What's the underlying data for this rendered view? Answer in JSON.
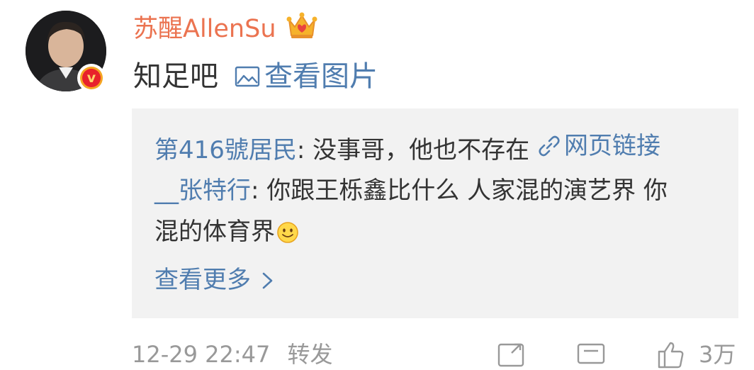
{
  "post": {
    "username": "苏醒AllenSu",
    "text": "知足吧",
    "view_image_label": "查看图片",
    "badge_letter": "v"
  },
  "comments": [
    {
      "name": "第416號居民",
      "separator": ": ",
      "text": "没事哥，他也不存在",
      "link_label": "网页链接"
    },
    {
      "name": "__张特行",
      "separator": ": ",
      "text_line1": "你跟王栎鑫比什么 人家混的演艺界 你",
      "text_line2": "混的体育界"
    }
  ],
  "view_more_label": "查看更多",
  "footer": {
    "timestamp": "12-29 22:47",
    "source": "转发",
    "like_count": "3万"
  },
  "icons": {
    "avatar": "avatar",
    "verified": "verified-v-icon",
    "crown": "crown-icon",
    "image": "image-icon",
    "link": "link-icon",
    "smile": "smile-emoji-icon",
    "chevron": "chevron-right-icon",
    "repost": "repost-icon",
    "comment": "comment-icon",
    "like": "like-icon"
  },
  "colors": {
    "username": "#eb7350",
    "link": "#507daf",
    "text": "#333333",
    "muted": "#999999",
    "comment_bg": "#f2f2f2"
  }
}
